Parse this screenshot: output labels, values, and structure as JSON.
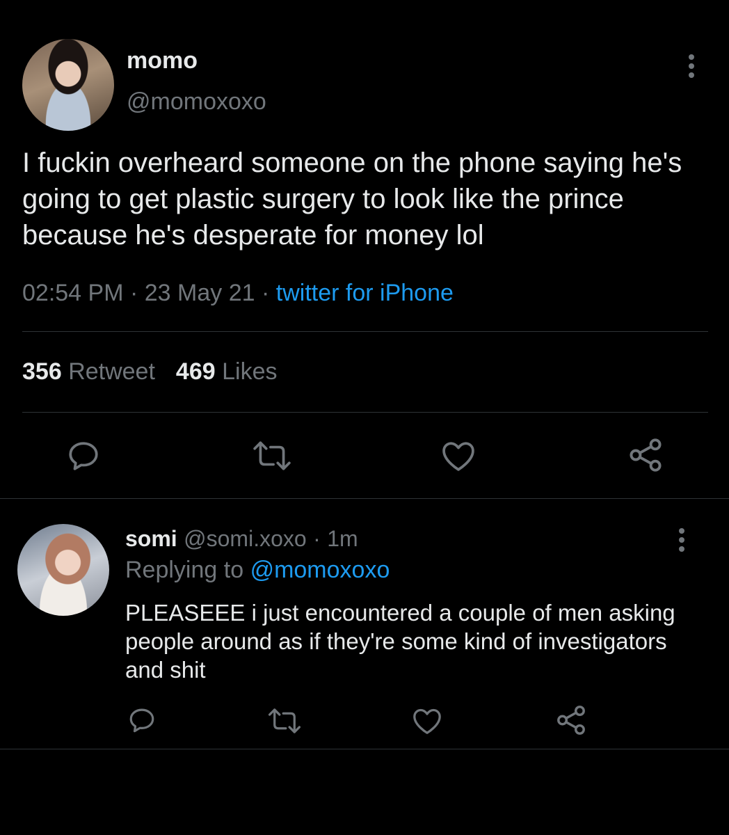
{
  "main_tweet": {
    "display_name": "momo",
    "handle": "@momoxoxo",
    "text": "I fuckin overheard someone on the phone saying he's going to get plastic surgery to look like the prince because he's desperate for money lol",
    "time": "02:54 PM",
    "date": "23 May 21",
    "source": "twitter for iPhone",
    "retweet_count": "356",
    "retweet_label": "Retweet",
    "like_count": "469",
    "like_label": "Likes"
  },
  "reply": {
    "display_name": "somi",
    "handle": "@somi.xoxo",
    "time_ago": "1m",
    "replying_label": "Replying to",
    "replying_to": "@momoxoxo",
    "text": "PLEASEEE i just encountered a couple of men asking people around as if they're some kind of investigators and shit"
  },
  "icons": {
    "more": "more-vertical-icon",
    "reply": "reply-icon",
    "retweet": "retweet-icon",
    "like": "heart-icon",
    "share": "share-icon"
  },
  "colors": {
    "background": "#000000",
    "text": "#e7e9ea",
    "secondary": "#71767b",
    "accent": "#1d9bf0",
    "divider": "#2f3336"
  }
}
